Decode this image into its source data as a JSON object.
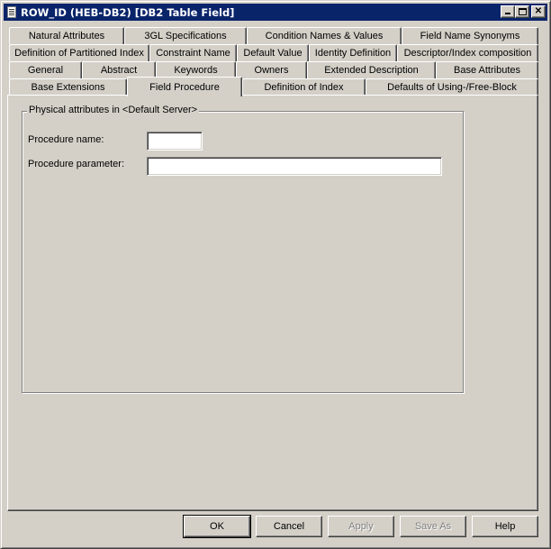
{
  "window": {
    "title": "ROW_ID (HEB-DB2) [DB2 Table Field]",
    "icon": "document-icon",
    "controls": [
      "minimize",
      "maximize",
      "close"
    ],
    "close_glyph": "✕"
  },
  "tabs": {
    "rows": [
      [
        "Natural Attributes",
        "3GL Specifications",
        "Condition Names & Values",
        "Field Name Synonyms"
      ],
      [
        "Definition of Partitioned Index",
        "Constraint Name",
        "Default Value",
        "Identity Definition",
        "Descriptor/Index composition"
      ],
      [
        "General",
        "Abstract",
        "Keywords",
        "Owners",
        "Extended Description",
        "Base Attributes"
      ],
      [
        "Base Extensions",
        "Field Procedure",
        "Definition of Index",
        "Defaults of Using-/Free-Block"
      ]
    ],
    "active": "Field Procedure"
  },
  "panel": {
    "group_title": "Physical attributes in <Default Server>",
    "fields": [
      {
        "label": "Procedure name:",
        "value": ""
      },
      {
        "label": "Procedure parameter:",
        "value": ""
      }
    ]
  },
  "buttons": [
    {
      "label": "OK",
      "enabled": true,
      "default": true
    },
    {
      "label": "Cancel",
      "enabled": true
    },
    {
      "label": "Apply",
      "enabled": false
    },
    {
      "label": "Save As",
      "enabled": false
    },
    {
      "label": "Help",
      "enabled": true
    }
  ],
  "colors": {
    "titlebar": "#0a246a",
    "face": "#d4d0c8",
    "disabled_text": "#808080"
  }
}
